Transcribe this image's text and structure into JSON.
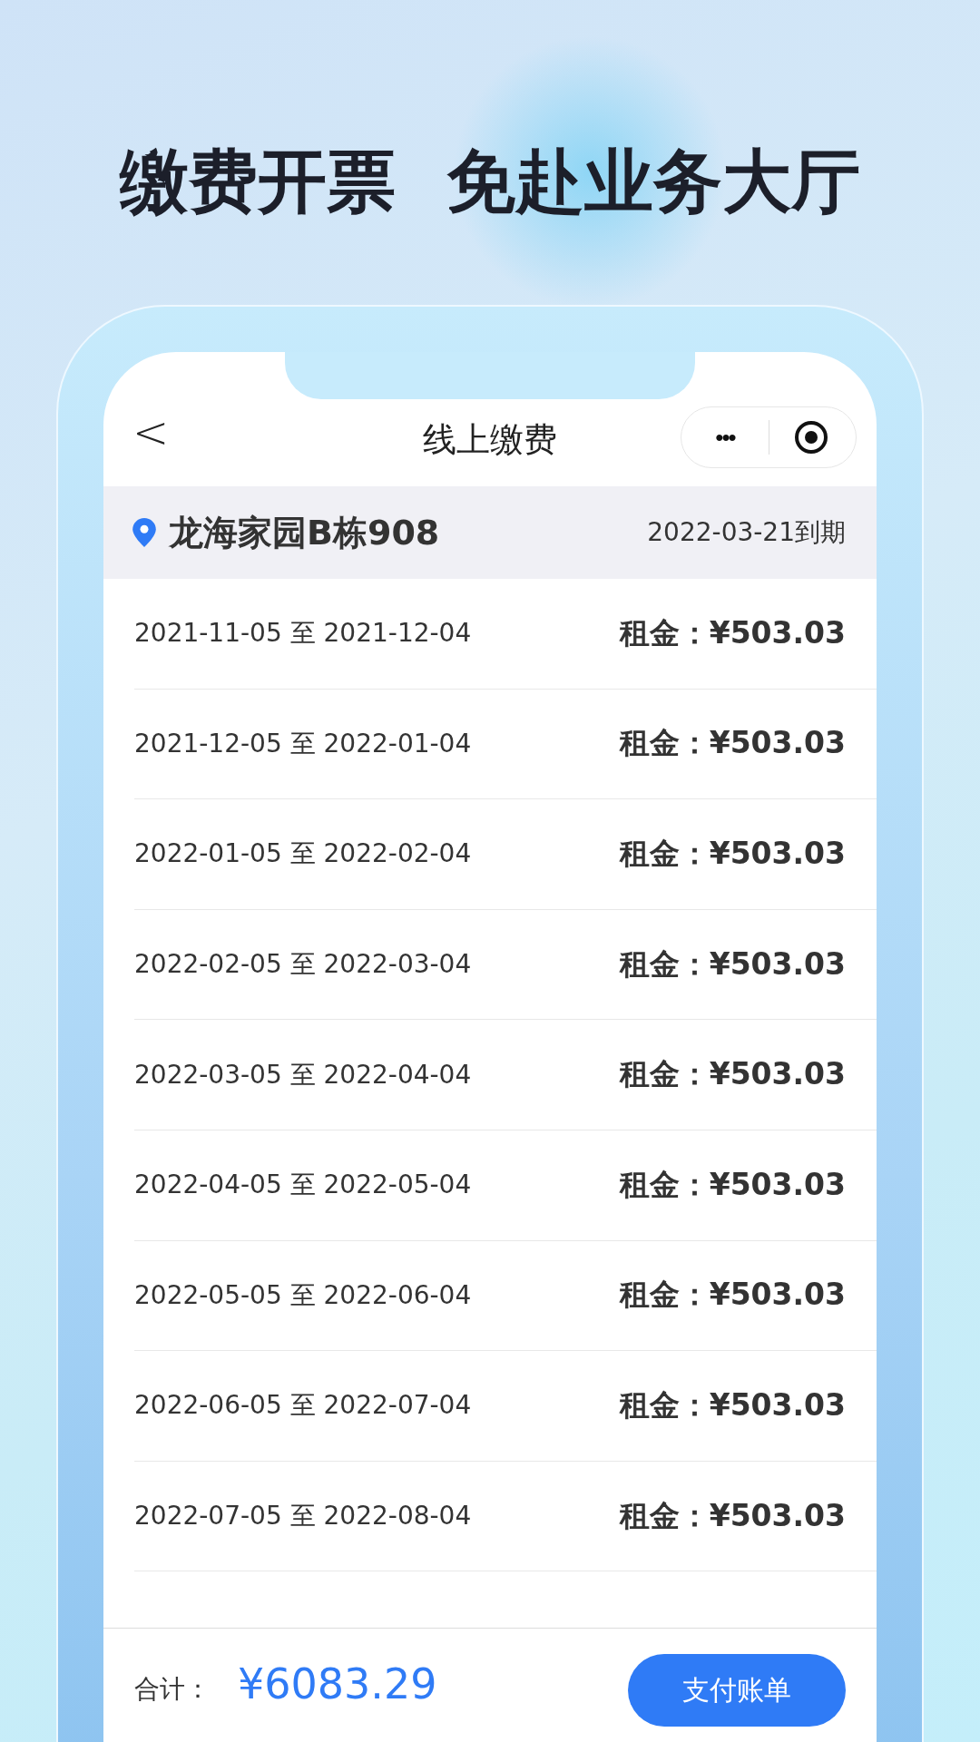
{
  "headline": [
    "缴费开票",
    "免赴业务大厅"
  ],
  "nav": {
    "back": "<",
    "title": "线上缴费",
    "more": "•••"
  },
  "location": {
    "name": "龙海家园B栋908",
    "due": "2022-03-21到期"
  },
  "rows": [
    {
      "period": "2021-11-05 至 2021-12-04",
      "amount": "租金：¥503.03"
    },
    {
      "period": "2021-12-05 至 2022-01-04",
      "amount": "租金：¥503.03"
    },
    {
      "period": "2022-01-05 至 2022-02-04",
      "amount": "租金：¥503.03"
    },
    {
      "period": "2022-02-05 至 2022-03-04",
      "amount": "租金：¥503.03"
    },
    {
      "period": "2022-03-05 至 2022-04-04",
      "amount": "租金：¥503.03"
    },
    {
      "period": "2022-04-05 至 2022-05-04",
      "amount": "租金：¥503.03"
    },
    {
      "period": "2022-05-05 至 2022-06-04",
      "amount": "租金：¥503.03"
    },
    {
      "period": "2022-06-05 至 2022-07-04",
      "amount": "租金：¥503.03"
    },
    {
      "period": "2022-07-05 至 2022-08-04",
      "amount": "租金：¥503.03"
    }
  ],
  "footer": {
    "label": "合计：",
    "total": "¥6083.29",
    "button": "支付账单"
  }
}
